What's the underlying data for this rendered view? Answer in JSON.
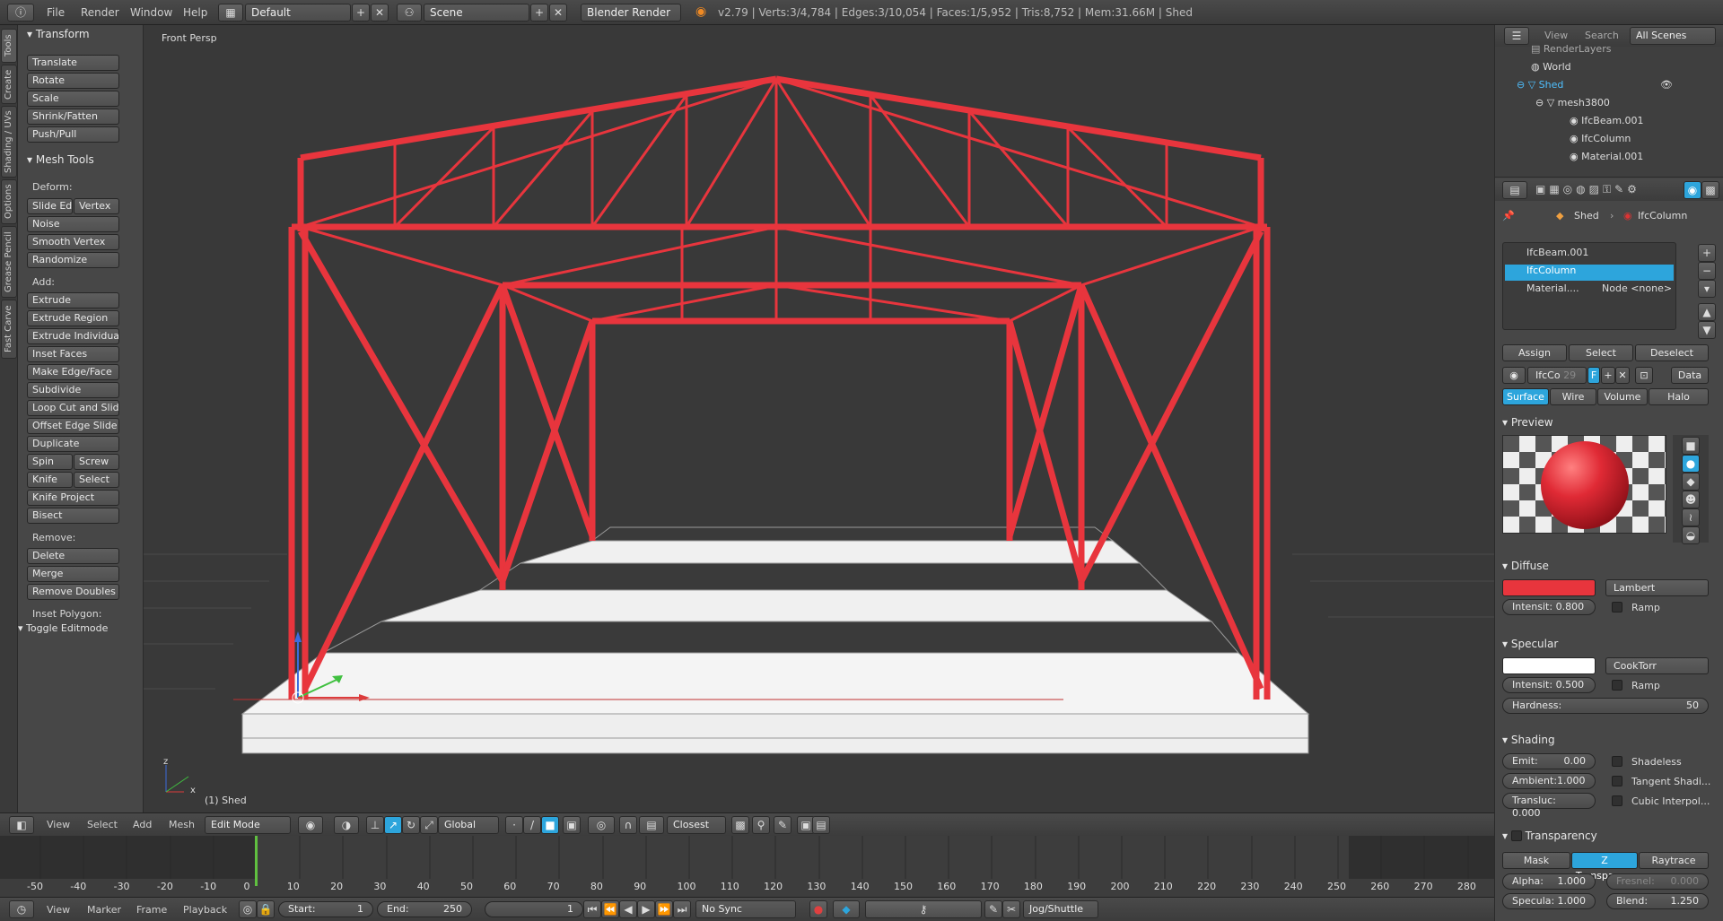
{
  "topbar": {
    "menus": [
      "File",
      "Render",
      "Window",
      "Help"
    ],
    "layout": "Default",
    "scene": "Scene",
    "engine": "Blender Render",
    "stats": "v2.79 | Verts:3/4,784 | Edges:3/10,054 | Faces:1/5,952 | Tris:8,752 | Mem:31.66M | Shed"
  },
  "left_tabs": [
    "Tools",
    "Create",
    "Shading / UVs",
    "Options",
    "Grease Pencil",
    "Fast Carve"
  ],
  "toolshelf": {
    "transform_title": "Transform",
    "transform": [
      "Translate",
      "Rotate",
      "Scale",
      "Shrink/Fatten",
      "Push/Pull"
    ],
    "mesh_tools_title": "Mesh Tools",
    "deform_label": "Deform:",
    "deform": {
      "slide_edge": "Slide Ed",
      "vertex": "Vertex",
      "noise": "Noise",
      "smooth": "Smooth Vertex",
      "randomize": "Randomize"
    },
    "add_label": "Add:",
    "add": {
      "extrude": "Extrude",
      "extrude_region": "Extrude Region",
      "extrude_individual": "Extrude Individual",
      "inset": "Inset Faces",
      "make_edge": "Make Edge/Face",
      "subdivide": "Subdivide",
      "loop_cut": "Loop Cut and Slide",
      "offset_edge": "Offset Edge Slide",
      "duplicate": "Duplicate",
      "spin": "Spin",
      "screw": "Screw",
      "knife": "Knife",
      "select": "Select",
      "knife_project": "Knife Project",
      "bisect": "Bisect"
    },
    "remove_label": "Remove:",
    "remove": {
      "delete": "Delete",
      "merge": "Merge",
      "remove_doubles": "Remove Doubles"
    },
    "inset_polygon": "Inset Polygon:",
    "toggle_editmode": "Toggle Editmode"
  },
  "viewport": {
    "label": "Front Persp",
    "object": "(1) Shed",
    "axis_x": "x",
    "axis_z": "z",
    "wire_color": "#e8353d",
    "slab_color": "#eeeeee"
  },
  "viewport_header": {
    "menus": [
      "View",
      "Select",
      "Add",
      "Mesh"
    ],
    "mode": "Edit Mode",
    "orientation": "Global",
    "snap": "Closest"
  },
  "timeline": {
    "ticks": [
      "-50",
      "-40",
      "-30",
      "-20",
      "-10",
      "0",
      "10",
      "20",
      "30",
      "40",
      "50",
      "60",
      "70",
      "80",
      "90",
      "100",
      "110",
      "120",
      "130",
      "140",
      "150",
      "160",
      "170",
      "180",
      "190",
      "200",
      "210",
      "220",
      "230",
      "240",
      "250",
      "260",
      "270",
      "280"
    ],
    "current_frame_value": 0,
    "menus": [
      "View",
      "Marker",
      "Frame",
      "Playback"
    ],
    "start_label": "Start:",
    "start": "1",
    "end_label": "End:",
    "end": "250",
    "current": "1",
    "sync": "No Sync",
    "jog": "Jog/Shuttle"
  },
  "outliner": {
    "view": "View",
    "search": "Search",
    "scope": "All Scenes",
    "items": [
      {
        "label": "RenderLayers",
        "indent": 40
      },
      {
        "label": "World",
        "indent": 40
      },
      {
        "label": "Shed",
        "indent": 30
      },
      {
        "label": "mesh3800",
        "indent": 60
      },
      {
        "label": "IfcBeam.001",
        "indent": 80
      },
      {
        "label": "IfcColumn",
        "indent": 80
      },
      {
        "label": "Material.001",
        "indent": 80
      }
    ]
  },
  "properties": {
    "breadcrumb_obj": "Shed",
    "breadcrumb_mat": "IfcColumn",
    "slots": [
      {
        "label": "IfcBeam.001",
        "extra": ""
      },
      {
        "label": "IfcColumn",
        "extra": ""
      },
      {
        "label": "Material....",
        "extra": "Node <none>"
      }
    ],
    "assign": "Assign",
    "select": "Select",
    "deselect": "Deselect",
    "mat_name": "IfcCo",
    "mat_users": "29",
    "mat_f": "F",
    "data": "Data",
    "tabs": [
      "Surface",
      "Wire",
      "Volume",
      "Halo"
    ],
    "preview_title": "Preview",
    "diffuse_title": "Diffuse",
    "diffuse_color": "#e8353d",
    "diffuse_shader": "Lambert",
    "diffuse_intensity": "Intensit: 0.800",
    "ramp": "Ramp",
    "specular_title": "Specular",
    "specular_color": "#ffffff",
    "specular_shader": "CookTorr",
    "specular_intensity": "Intensit: 0.500",
    "hardness_label": "Hardness:",
    "hardness": "50",
    "shading_title": "Shading",
    "emit": "Emit:",
    "emit_val": "0.00",
    "ambient": "Ambient:1.000",
    "transluc": "Transluc: 0.000",
    "shadeless": "Shadeless",
    "tangent": "Tangent Shadi...",
    "cubic": "Cubic Interpol...",
    "transparency_title": "Transparency",
    "mask": "Mask",
    "ztransp": "Z Transpare...",
    "raytrace": "Raytrace",
    "alpha": "Alpha:",
    "alpha_val": "1.000",
    "fresnel": "Fresnel:",
    "fresnel_val": "0.000",
    "specula": "Specula:",
    "specula_val": "1.000",
    "blend": "Blend:",
    "blend_val": "1.250"
  }
}
